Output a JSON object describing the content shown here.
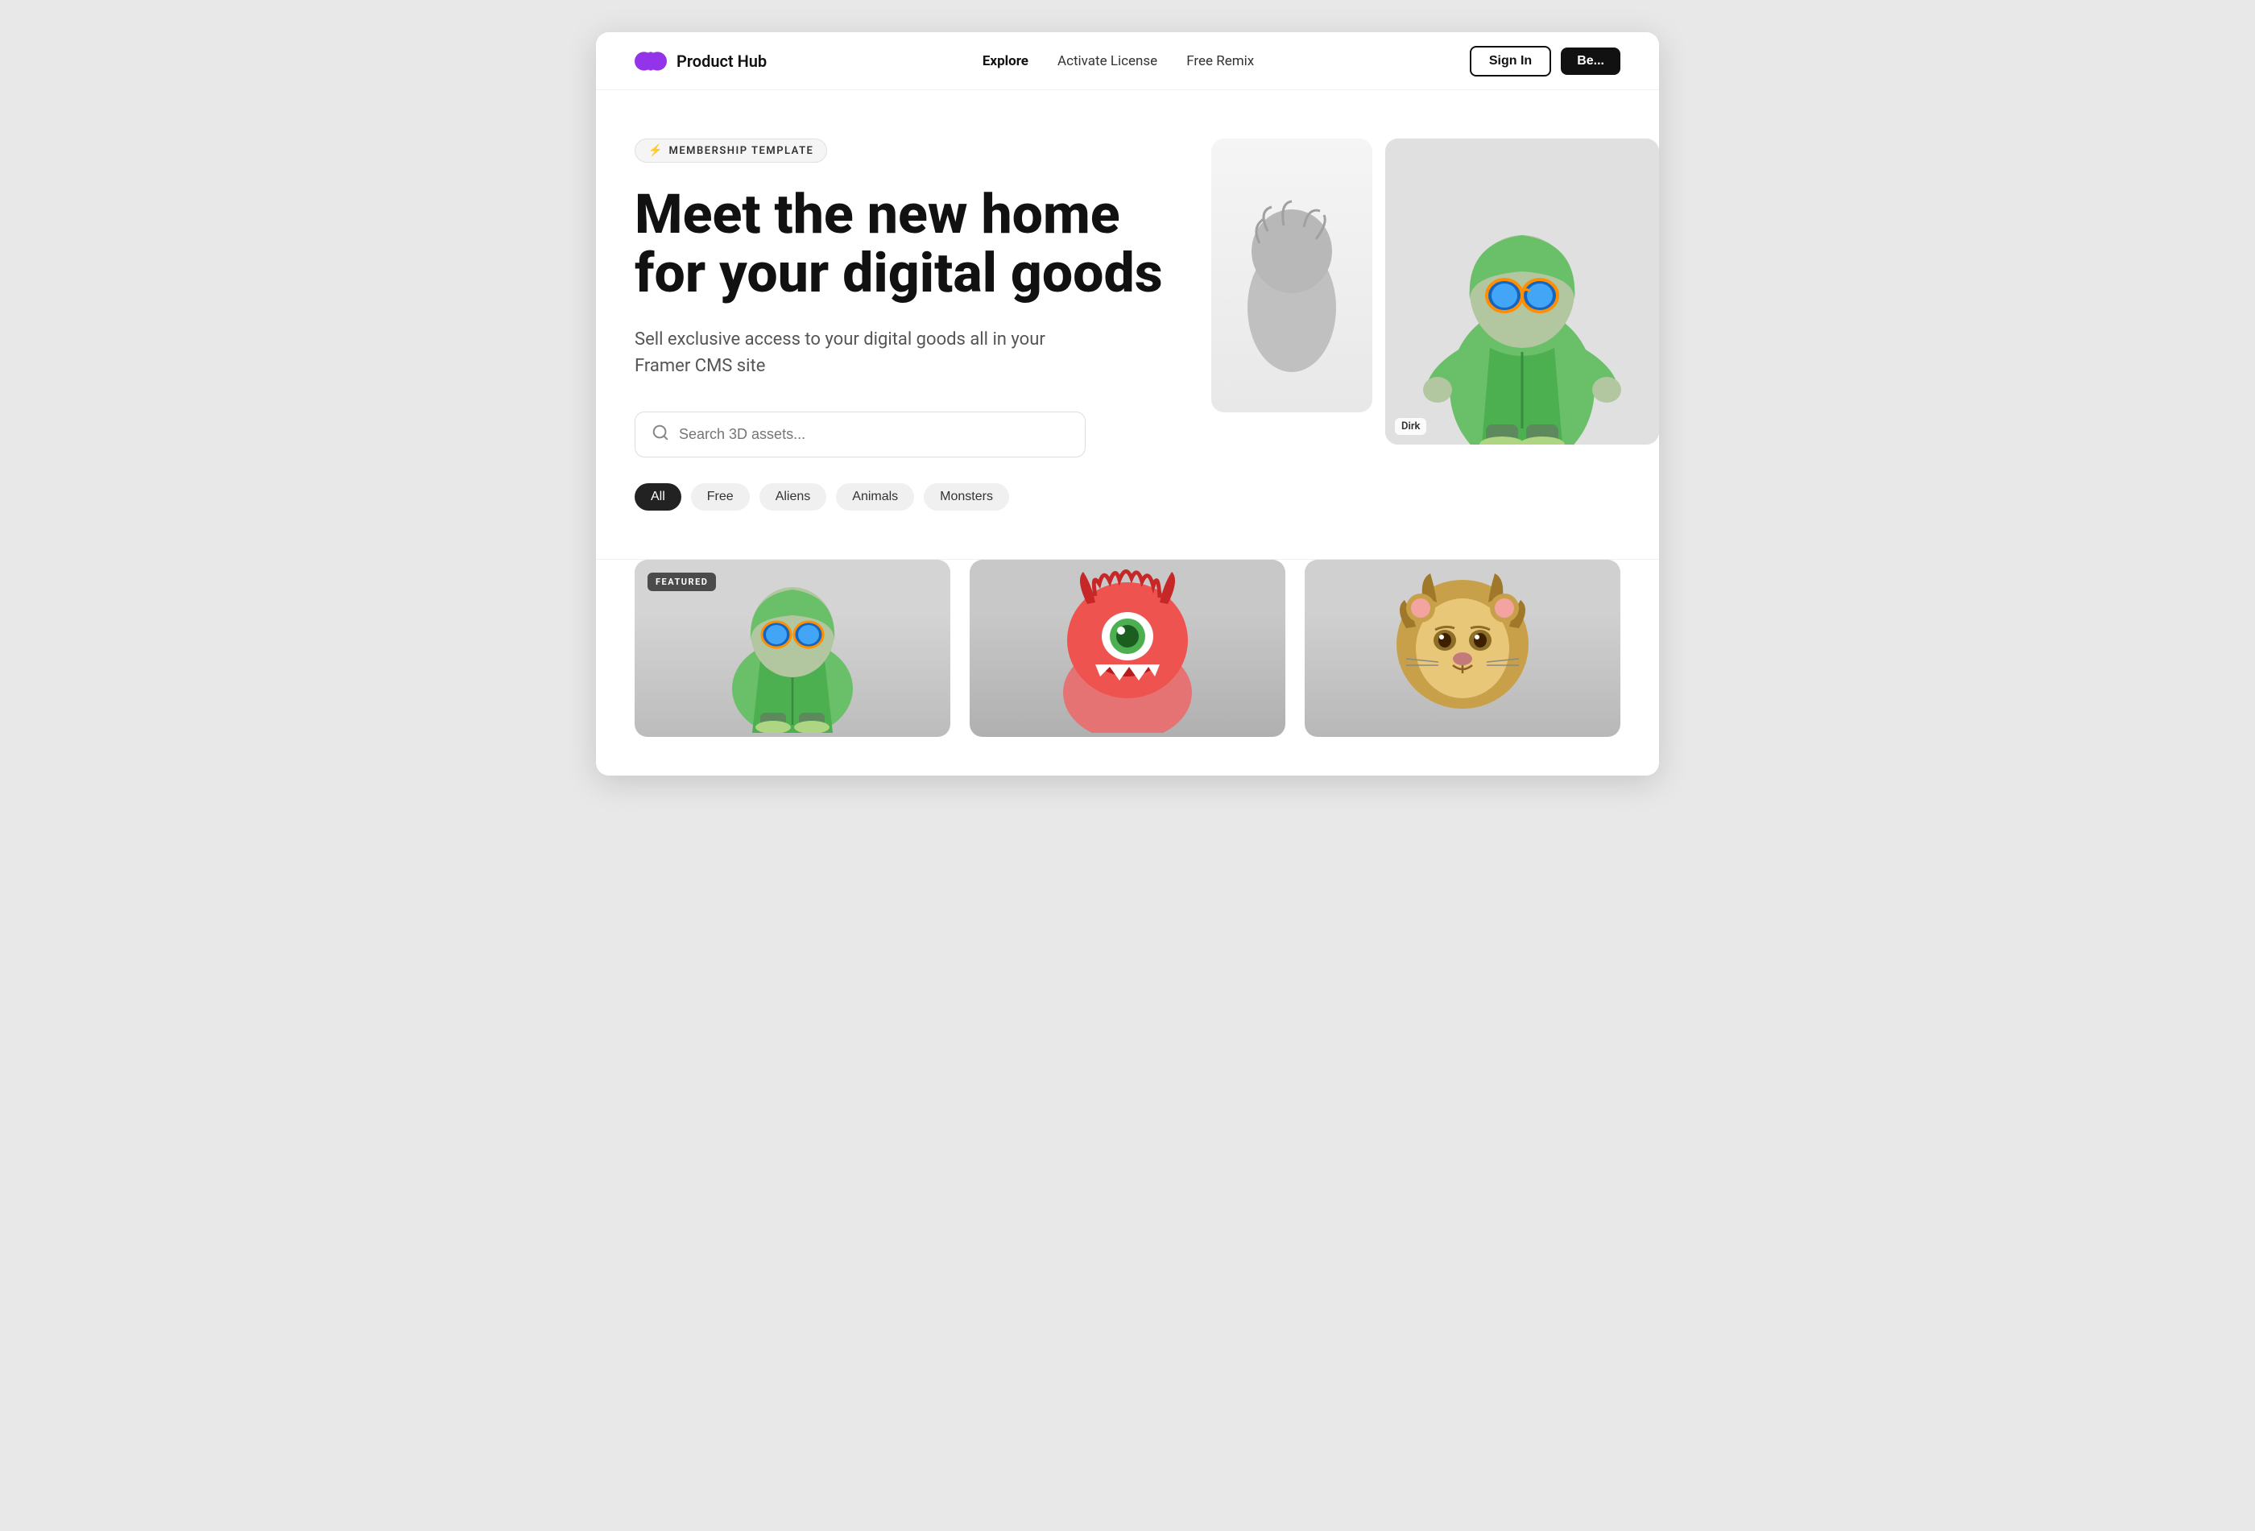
{
  "navbar": {
    "brand": "Product Hub",
    "logo_alt": "product-hub-logo",
    "links": [
      {
        "label": "Explore",
        "active": true,
        "id": "explore"
      },
      {
        "label": "Activate License",
        "active": false,
        "id": "activate-license"
      },
      {
        "label": "Free Remix",
        "active": false,
        "id": "free-remix"
      }
    ],
    "signin_label": "Sign In",
    "begin_label": "Be..."
  },
  "hero": {
    "badge": {
      "icon": "⚡",
      "text": "MEMBERSHIP TEMPLATE"
    },
    "title": "Meet the new home for your digital goods",
    "subtitle": "Sell exclusive access to your digital goods all in your Framer CMS site",
    "search": {
      "placeholder": "Search 3D assets...",
      "icon": "search"
    },
    "filters": [
      {
        "label": "All",
        "active": true
      },
      {
        "label": "Free",
        "active": false
      },
      {
        "label": "Aliens",
        "active": false
      },
      {
        "label": "Animals",
        "active": false
      },
      {
        "label": "Monsters",
        "active": false
      }
    ],
    "card_label": "Dirk"
  },
  "products": {
    "items": [
      {
        "featured": true,
        "type": "alien-green",
        "emoji": "👽"
      },
      {
        "featured": false,
        "type": "monster-red",
        "emoji": "👹"
      },
      {
        "featured": false,
        "type": "lion",
        "emoji": "🦁"
      }
    ]
  }
}
